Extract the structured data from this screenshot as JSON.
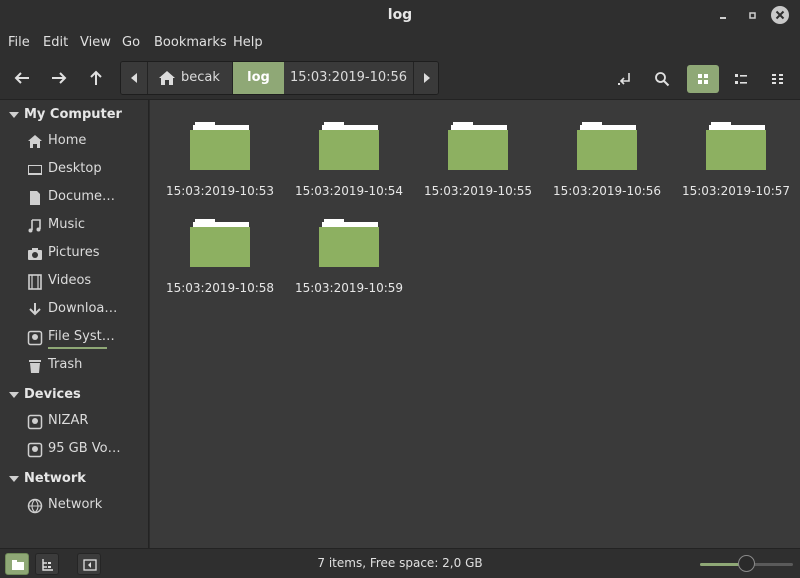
{
  "window": {
    "title": "log"
  },
  "menu": [
    "File",
    "Edit",
    "View",
    "Go",
    "Bookmarks",
    "Help"
  ],
  "pathbar": {
    "home": "becak",
    "active": "log",
    "next": "15:03:2019-10:56"
  },
  "sidebar": {
    "sections": [
      {
        "label": "My Computer",
        "items": [
          {
            "label": "Home",
            "icon": "home-icon"
          },
          {
            "label": "Desktop",
            "icon": "desktop-icon"
          },
          {
            "label": "Docume…",
            "icon": "document-icon"
          },
          {
            "label": "Music",
            "icon": "music-icon"
          },
          {
            "label": "Pictures",
            "icon": "camera-icon"
          },
          {
            "label": "Videos",
            "icon": "film-icon"
          },
          {
            "label": "Downloa…",
            "icon": "download-icon"
          },
          {
            "label": "File Syst…",
            "icon": "drive-icon",
            "usage_fraction": 1.0
          },
          {
            "label": "Trash",
            "icon": "trash-icon"
          }
        ]
      },
      {
        "label": "Devices",
        "items": [
          {
            "label": "NIZAR",
            "icon": "drive-icon"
          },
          {
            "label": "95 GB Vo…",
            "icon": "drive-icon"
          }
        ]
      },
      {
        "label": "Network",
        "items": [
          {
            "label": "Network",
            "icon": "network-icon"
          }
        ]
      }
    ]
  },
  "files": [
    "15:03:2019-10:53",
    "15:03:2019-10:54",
    "15:03:2019-10:55",
    "15:03:2019-10:56",
    "15:03:2019-10:57",
    "15:03:2019-10:58",
    "15:03:2019-10:59"
  ],
  "status": {
    "text": "7 items, Free space: 2,0 GB",
    "zoom_fraction": 0.5
  },
  "colors": {
    "accent": "#8fa876",
    "folder": "#8db061",
    "background": "#3a3a3a",
    "sidebar": "#353535"
  }
}
